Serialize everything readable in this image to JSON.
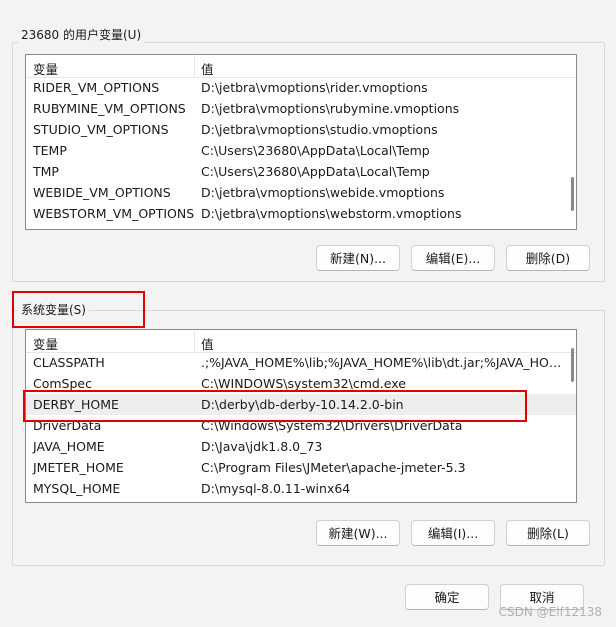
{
  "user_vars": {
    "title": "23680 的用户变量(U)",
    "col_name": "变量",
    "col_value": "值",
    "rows": [
      {
        "name": "RIDER_VM_OPTIONS",
        "value": "D:\\jetbra\\vmoptions\\rider.vmoptions"
      },
      {
        "name": "RUBYMINE_VM_OPTIONS",
        "value": "D:\\jetbra\\vmoptions\\rubymine.vmoptions"
      },
      {
        "name": "STUDIO_VM_OPTIONS",
        "value": "D:\\jetbra\\vmoptions\\studio.vmoptions"
      },
      {
        "name": "TEMP",
        "value": "C:\\Users\\23680\\AppData\\Local\\Temp"
      },
      {
        "name": "TMP",
        "value": "C:\\Users\\23680\\AppData\\Local\\Temp"
      },
      {
        "name": "WEBIDE_VM_OPTIONS",
        "value": "D:\\jetbra\\vmoptions\\webide.vmoptions"
      },
      {
        "name": "WEBSTORM_VM_OPTIONS",
        "value": "D:\\jetbra\\vmoptions\\webstorm.vmoptions"
      }
    ],
    "btn_new": "新建(N)...",
    "btn_edit": "编辑(E)...",
    "btn_delete": "删除(D)"
  },
  "system_vars": {
    "title": "系统变量(S)",
    "col_name": "变量",
    "col_value": "值",
    "rows": [
      {
        "name": "CLASSPATH",
        "value": ".;%JAVA_HOME%\\lib;%JAVA_HOME%\\lib\\dt.jar;%JAVA_HOME..."
      },
      {
        "name": "ComSpec",
        "value": "C:\\WINDOWS\\system32\\cmd.exe"
      },
      {
        "name": "DERBY_HOME",
        "value": "D:\\derby\\db-derby-10.14.2.0-bin",
        "selected": true
      },
      {
        "name": "DriverData",
        "value": "C:\\Windows\\System32\\Drivers\\DriverData"
      },
      {
        "name": "JAVA_HOME",
        "value": "D:\\Java\\jdk1.8.0_73"
      },
      {
        "name": "JMETER_HOME",
        "value": "C:\\Program Files\\JMeter\\apache-jmeter-5.3"
      },
      {
        "name": "MYSQL_HOME",
        "value": "D:\\mysql-8.0.11-winx64"
      }
    ],
    "btn_new": "新建(W)...",
    "btn_edit": "编辑(I)...",
    "btn_delete": "删除(L)"
  },
  "dialog": {
    "ok": "确定",
    "cancel": "取消"
  },
  "watermark": "CSDN @Elf12138",
  "colors": {
    "annotation": "#e00000",
    "selection": "#eeeeee"
  }
}
